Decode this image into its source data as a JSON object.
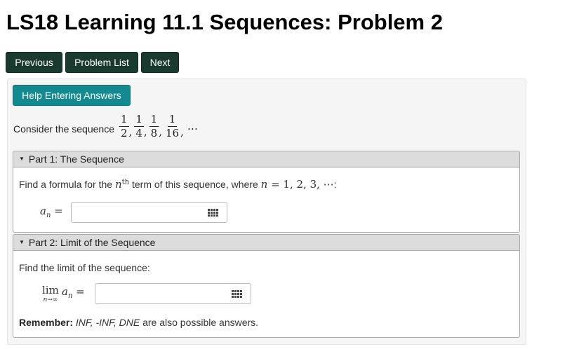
{
  "page": {
    "title": "LS18 Learning 11.1 Sequences: Problem 2"
  },
  "nav": {
    "previous_label": "Previous",
    "problem_list_label": "Problem List",
    "next_label": "Next"
  },
  "problem": {
    "help_label": "Help Entering Answers",
    "intro": "Consider the sequence",
    "sequence": {
      "terms": [
        {
          "num": "1",
          "den": "2"
        },
        {
          "num": "1",
          "den": "4"
        },
        {
          "num": "1",
          "den": "8"
        },
        {
          "num": "1",
          "den": "16"
        }
      ],
      "ellipsis": "…"
    },
    "parts": [
      {
        "header": "Part 1: The Sequence",
        "prompt_before": "Find a formula for the ",
        "prompt_var": "n",
        "prompt_sup": "th",
        "prompt_middle": " term of this sequence, where ",
        "prompt_math_var": "n",
        "prompt_math_rest": " = 1, 2, 3, ⋯",
        "prompt_end": ":",
        "answer_label_var": "a",
        "answer_label_sub": "n",
        "answer_label_eq": " =",
        "answer_value": "",
        "palette_icon": "grid-icon"
      },
      {
        "header": "Part 2: Limit of the Sequence",
        "prompt": "Find the limit of the sequence:",
        "answer_lim": "lim",
        "answer_lim_sub": "n→∞",
        "answer_label_var": "a",
        "answer_label_sub": "n",
        "answer_label_eq": " =",
        "answer_value": "",
        "palette_icon": "grid-icon",
        "remember_label": "Remember:",
        "remember_values": "INF, -INF, DNE",
        "remember_rest": " are also possible answers."
      }
    ]
  },
  "colors": {
    "nav_button": "#1a3a2f",
    "help_button": "#138a8f",
    "part_header": "#dcdcdc"
  }
}
